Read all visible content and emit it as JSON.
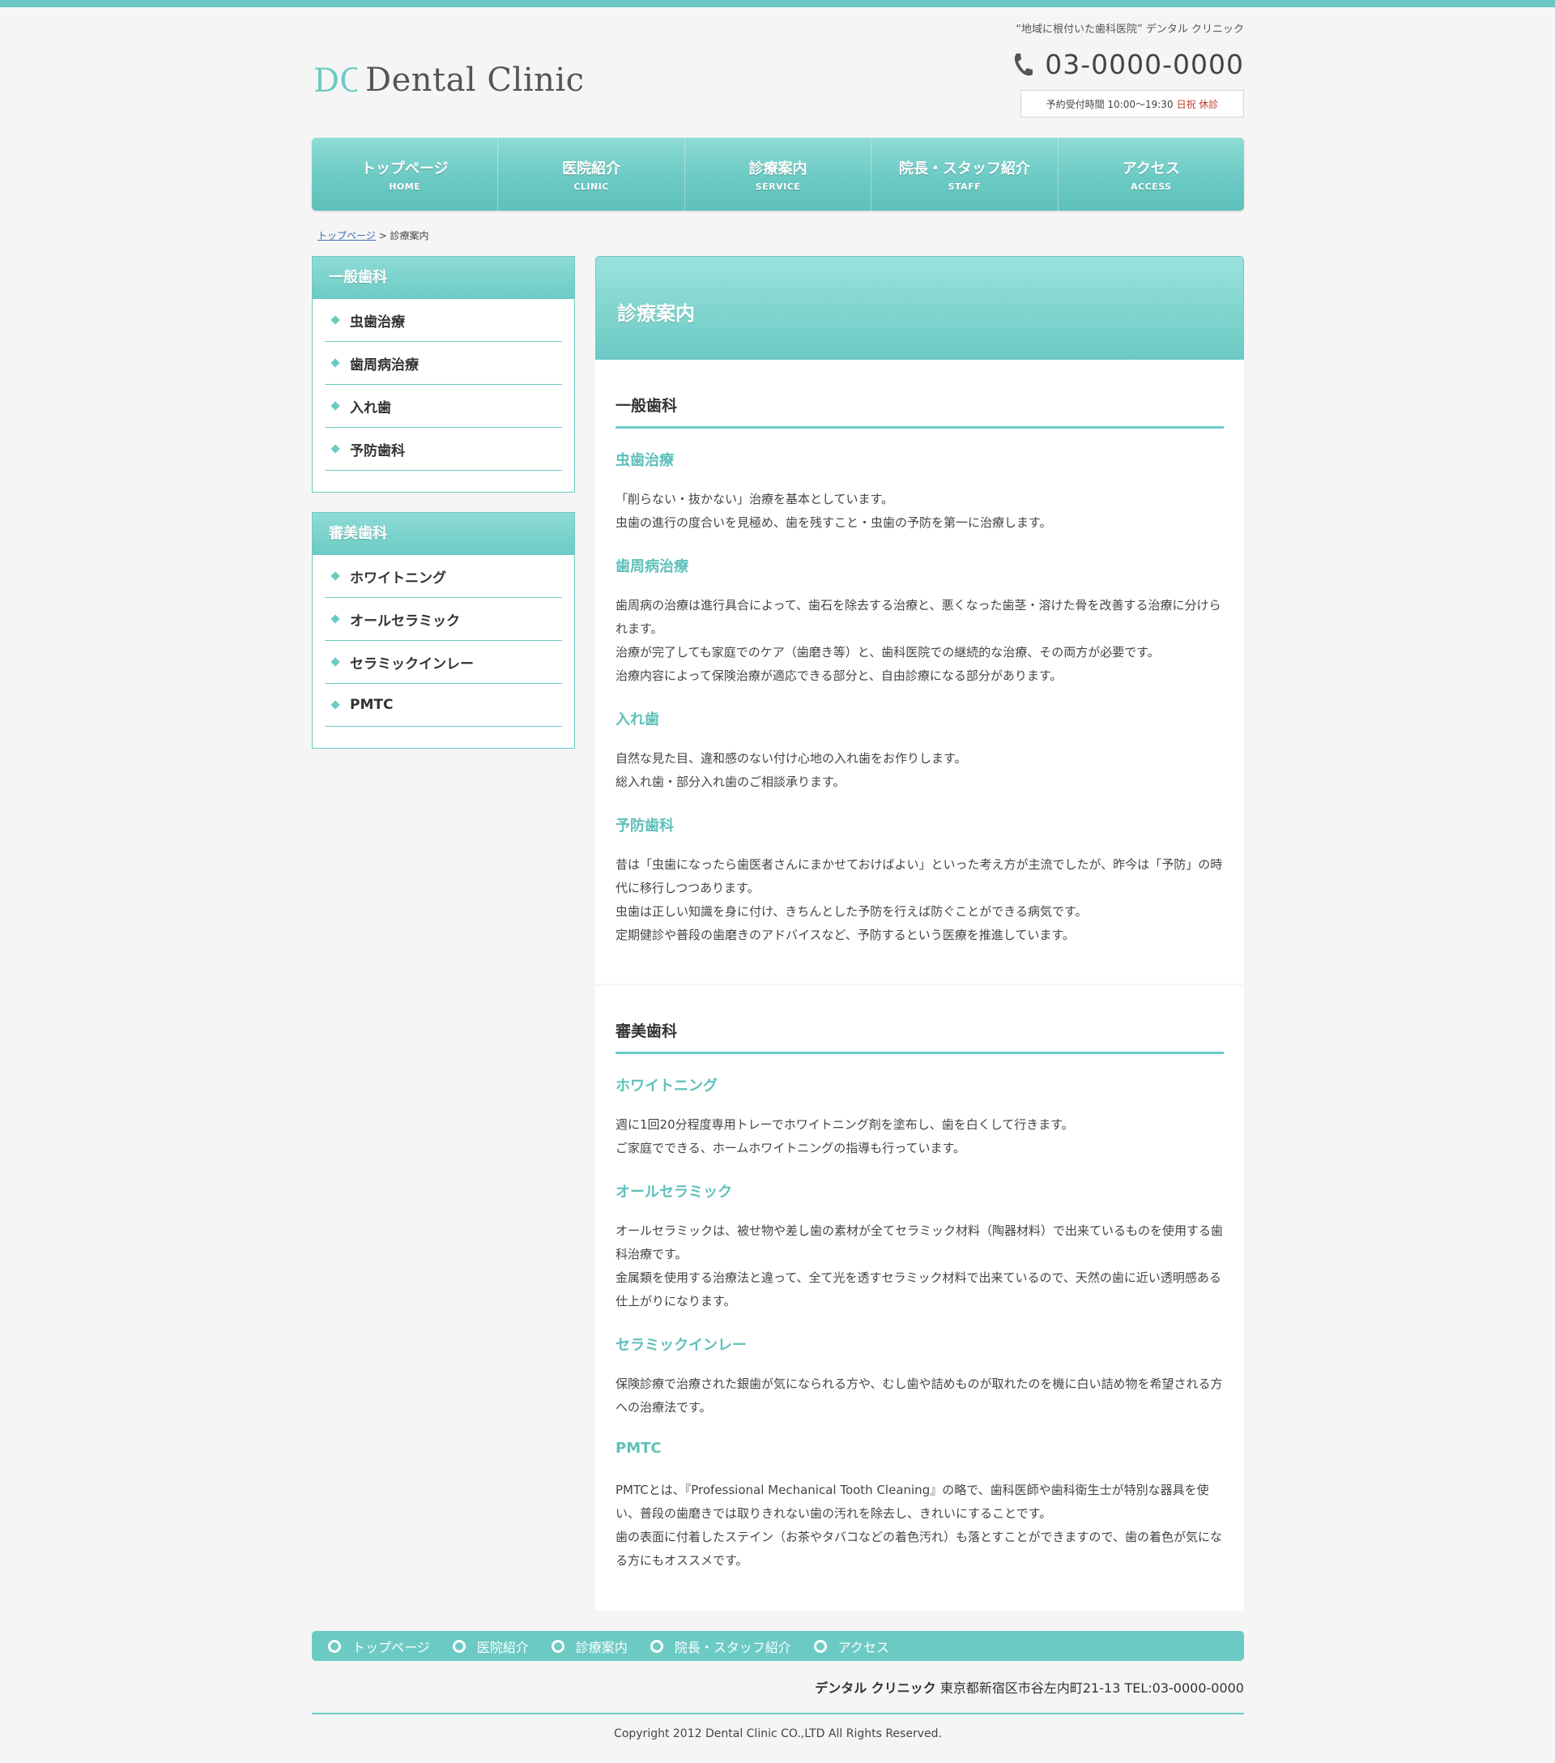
{
  "colors": {
    "accent": "#6ccac4",
    "text": "#444444",
    "closed": "#c0392b",
    "link": "#3a6fb0"
  },
  "header": {
    "tagline": "“地域に根付いた歯科医院” デンタル クリニック",
    "logo_text": "Dental Clinic",
    "logo_mark": "DC",
    "phone_icon": "phone-icon",
    "phone": "03-0000-0000",
    "hours": "予約受付時間 10:00～19:30",
    "closed": "日祝 休診"
  },
  "nav": [
    {
      "jp": "トップページ",
      "en": "HOME"
    },
    {
      "jp": "医院紹介",
      "en": "CLINIC"
    },
    {
      "jp": "診療案内",
      "en": "SERVICE"
    },
    {
      "jp": "院長・スタッフ紹介",
      "en": "STAFF"
    },
    {
      "jp": "アクセス",
      "en": "ACCESS"
    }
  ],
  "breadcrumb": {
    "home": "トップページ",
    "sep": ">",
    "current": "診療案内"
  },
  "sidebar": [
    {
      "title": "一般歯科",
      "items": [
        "虫歯治療",
        "歯周病治療",
        "入れ歯",
        "予防歯科"
      ]
    },
    {
      "title": "審美歯科",
      "items": [
        "ホワイトニング",
        "オールセラミック",
        "セラミックインレー",
        "PMTC"
      ]
    }
  ],
  "main": {
    "title": "診療案内",
    "sections": [
      {
        "title": "一般歯科",
        "subs": [
          {
            "title": "虫歯治療",
            "text": "「削らない・抜かない」治療を基本としています。\n虫歯の進行の度合いを見極め、歯を残すこと・虫歯の予防を第一に治療します。"
          },
          {
            "title": "歯周病治療",
            "text": "歯周病の治療は進行具合によって、歯石を除去する治療と、悪くなった歯茎・溶けた骨を改善する治療に分けられます。\n治療が完了しても家庭でのケア（歯磨き等）と、歯科医院での継続的な治療、その両方が必要です。\n治療内容によって保険治療が適応できる部分と、自由診療になる部分があります。"
          },
          {
            "title": "入れ歯",
            "text": "自然な見た目、違和感のない付け心地の入れ歯をお作りします。\n総入れ歯・部分入れ歯のご相談承ります。"
          },
          {
            "title": "予防歯科",
            "text": "昔は「虫歯になったら歯医者さんにまかせておけばよい」といった考え方が主流でしたが、昨今は「予防」の時代に移行しつつあります。\n虫歯は正しい知識を身に付け、きちんとした予防を行えば防ぐことができる病気です。\n定期健診や普段の歯磨きのアドバイスなど、予防するという医療を推進しています。"
          }
        ]
      },
      {
        "title": "審美歯科",
        "subs": [
          {
            "title": "ホワイトニング",
            "text": "週に1回20分程度専用トレーでホワイトニング剤を塗布し、歯を白くして行きます。\nご家庭でできる、ホームホワイトニングの指導も行っています。"
          },
          {
            "title": "オールセラミック",
            "text": "オールセラミックは、被せ物や差し歯の素材が全てセラミック材料（陶器材料）で出来ているものを使用する歯科治療です。\n金属類を使用する治療法と違って、全て光を透すセラミック材料で出来ているので、天然の歯に近い透明感ある仕上がりになります。"
          },
          {
            "title": "セラミックインレー",
            "text": "保険診療で治療された銀歯が気になられる方や、むし歯や詰めものが取れたのを機に白い詰め物を希望される方への治療法です。"
          },
          {
            "title": "PMTC",
            "text": "PMTCとは、『Professional Mechanical Tooth Cleaning』の略で、歯科医師や歯科衛生士が特別な器具を使い、普段の歯磨きでは取りきれない歯の汚れを除去し、きれいにすることです。\n歯の表面に付着したステイン（お茶やタバコなどの着色汚れ）も落とすことができますので、歯の着色が気になる方にもオススメです。"
          }
        ]
      }
    ]
  },
  "footer": {
    "links": [
      "トップページ",
      "医院紹介",
      "診療案内",
      "院長・スタッフ紹介",
      "アクセス"
    ],
    "clinic_name": "デンタル クリニック",
    "address": "東京都新宿区市谷左内町21-13 TEL:03-0000-0000",
    "copyright": "Copyright 2012 Dental Clinic CO.,LTD All Rights Reserved."
  }
}
